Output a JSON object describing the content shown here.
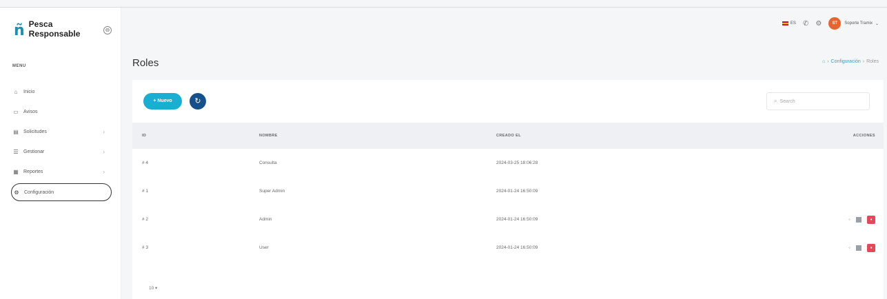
{
  "brand": {
    "logo": "ñ",
    "line1": "Pesca",
    "line2": "Responsable",
    "toggle": "⊖"
  },
  "sidebar": {
    "heading": "MENU",
    "items": [
      {
        "icon": "home-icon",
        "glyph": "⌂",
        "label": "Inicio",
        "arrow": ""
      },
      {
        "icon": "calendar-icon",
        "glyph": "▭",
        "label": "Avisos",
        "arrow": ""
      },
      {
        "icon": "file-icon",
        "glyph": "▤",
        "label": "Solicitudes",
        "arrow": "›"
      },
      {
        "icon": "list-icon",
        "glyph": "☰",
        "label": "Gestionar",
        "arrow": "›"
      },
      {
        "icon": "chart-icon",
        "glyph": "▦",
        "label": "Reportes",
        "arrow": "›"
      },
      {
        "icon": "gear-icon",
        "glyph": "⚙",
        "label": "Configuración",
        "arrow": ""
      }
    ]
  },
  "header": {
    "lang": "ES",
    "user_initials": "ST",
    "user_name": "Soporte Tramix"
  },
  "page": {
    "title": "Roles",
    "breadcrumb": {
      "home": "⌂",
      "sep": "›",
      "section": "Configuración",
      "current": "Roles"
    }
  },
  "toolbar": {
    "new_label": "+ Nuevo",
    "refresh_glyph": "↻",
    "search_placeholder": "Search"
  },
  "table": {
    "columns": [
      "ID",
      "NOMBRE",
      "CREADO EL",
      "ACCIONES"
    ],
    "rows": [
      {
        "id": "# 4",
        "name": "Consulta",
        "created": "2024-03-25 18:06:28",
        "actions": false
      },
      {
        "id": "# 1",
        "name": "Super Admin",
        "created": "2024-01-24 16:50:09",
        "actions": false
      },
      {
        "id": "# 2",
        "name": "Admin",
        "created": "2024-01-24 16:50:09",
        "actions": true
      },
      {
        "id": "# 3",
        "name": "User",
        "created": "2024-01-24 16:50:09",
        "actions": true
      }
    ]
  },
  "pagination": {
    "page_size": "10 ▾"
  }
}
